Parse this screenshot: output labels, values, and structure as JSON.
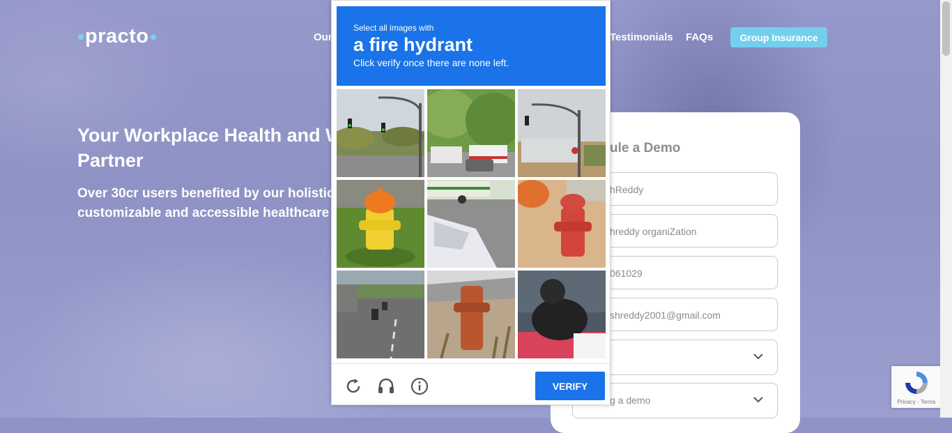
{
  "site": {
    "logo": "practo",
    "nav": {
      "item_our": "Our",
      "testimonials": "Testimonials",
      "faqs": "FAQs",
      "cta": "Group Insurance"
    },
    "hero": {
      "title": "Your Workplace Health and W",
      "title_line2": "Partner",
      "subtitle": "Over 30cr users benefited by our holistic,",
      "subtitle_line2": "customizable and accessible healthcare s"
    },
    "form": {
      "title": "ule a Demo",
      "name_value": "hReddy",
      "org_value": "hreddy organiZation",
      "phone_value": "061029",
      "email_value": "shreddy2001@gmail.com",
      "select1_value": "",
      "select2_value": "g a demo"
    }
  },
  "captcha": {
    "instruction_top": "Select all images with",
    "target": "a fire hydrant",
    "instruction_bottom": "Click verify once there are none left.",
    "verify_label": "VERIFY",
    "tiles": [
      "traffic light street",
      "trees and bus street",
      "traffic light lot",
      "yellow fire hydrant",
      "bus and car street",
      "red fire hydrant",
      "road with motorbikes",
      "rusty fire hydrant",
      "motorcycle"
    ],
    "colors": {
      "header": "#1a73e8",
      "verify": "#1a73e8"
    }
  },
  "badge": {
    "text": "Privacy - Terms"
  }
}
